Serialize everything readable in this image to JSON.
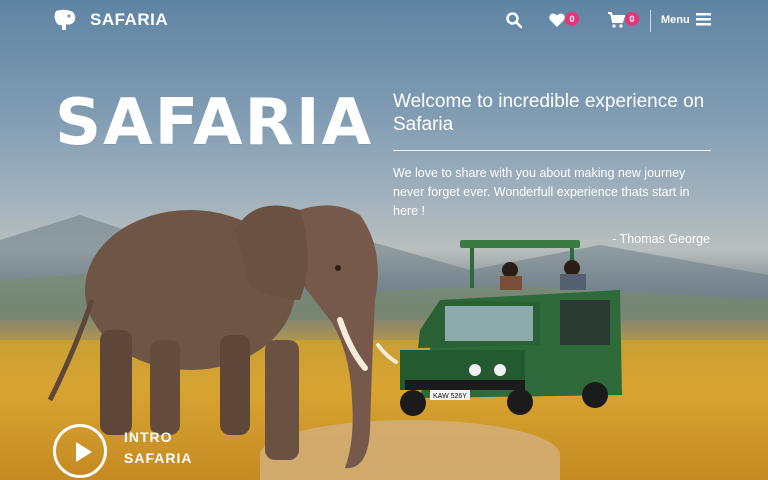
{
  "brand": {
    "name": "SAFARIA"
  },
  "nav": {
    "wishlist_count": "0",
    "cart_count": "0",
    "menu_label": "Menu",
    "icons": [
      "search-icon",
      "heart-icon",
      "cart-icon",
      "hamburger-icon"
    ]
  },
  "hero": {
    "title": "SAFARIA",
    "welcome": "Welcome to incredible experience on Safaria",
    "description": "We love to share with you about making new journey never forget ever. Wonderfull experience thats start in here !",
    "author": "- Thomas George",
    "intro_line1": "INTRO",
    "intro_line2": "SAFARIA"
  },
  "vehicle": {
    "plate": "KAW 526Y"
  },
  "colors": {
    "badge": "#e8357a",
    "jeep": "#2f6b3a",
    "text": "#ffffff"
  }
}
